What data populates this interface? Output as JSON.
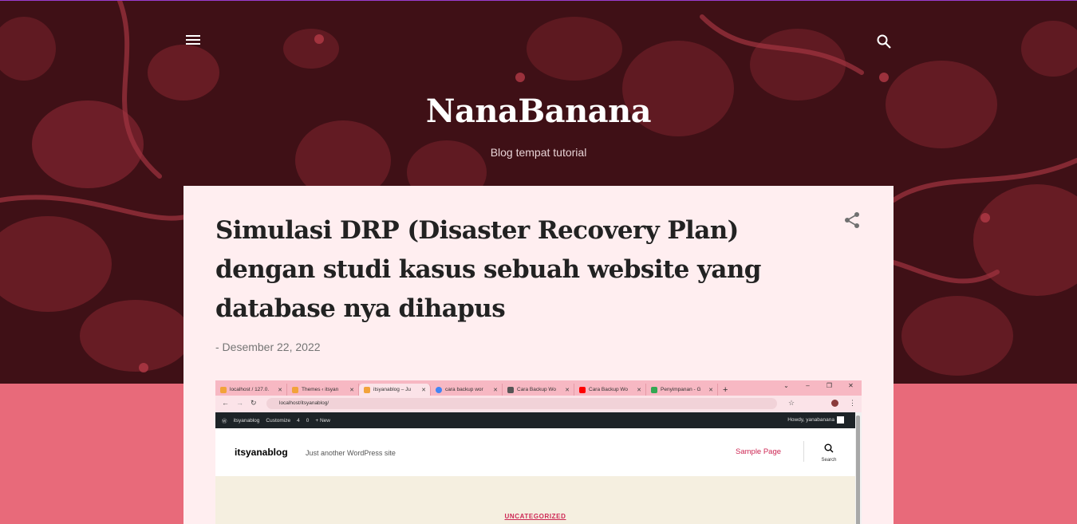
{
  "header": {
    "title": "NanaBanana",
    "description": "Blog tempat tutorial",
    "menu_icon": "hamburger-menu-icon",
    "search_icon": "search-icon"
  },
  "post": {
    "title": "Simulasi DRP (Disaster Recovery Plan) dengan studi kasus sebuah website yang database nya dihapus",
    "date": "- Desember 22, 2022",
    "share_icon": "share-icon"
  },
  "screenshot": {
    "tabs": [
      {
        "label": "localhost / 127.0.",
        "color": "#f2a33a"
      },
      {
        "label": "Themes ‹ itsyan",
        "color": "#f2a33a"
      },
      {
        "label": "itsyanablog – Ju",
        "color": "#f2a33a"
      },
      {
        "label": "cara backup wor",
        "color": "#4285f4"
      },
      {
        "label": "Cara Backup Wo",
        "color": "#555555"
      },
      {
        "label": "Cara Backup Wo",
        "color": "#ff0000"
      },
      {
        "label": "Penyimpanan - G",
        "color": "#34a853"
      }
    ],
    "url": "localhost/itsyanablog/",
    "wp_admin_bar": {
      "site": "itsyanablog",
      "customize": "Customize",
      "updates": "4",
      "comments": "0",
      "new": "+ New",
      "howdy": "Howdy, yanabanana"
    },
    "site_name": "itsyanablog",
    "site_tagline": "Just another WordPress site",
    "nav_link": "Sample Page",
    "search_label": "Search",
    "category": "UNCATEGORIZED"
  },
  "colors": {
    "header_bg": "#3f1016",
    "floral": "#8e2a34",
    "page_bg": "#e86a7a",
    "card_bg": "#ffeef0"
  }
}
